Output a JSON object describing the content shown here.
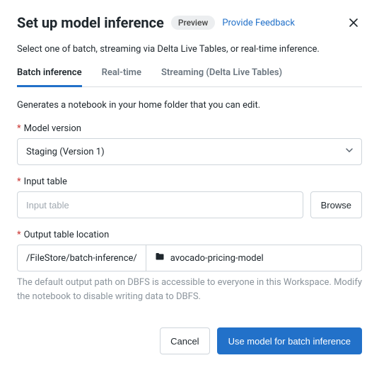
{
  "header": {
    "title": "Set up model inference",
    "badge": "Preview",
    "feedback": "Provide Feedback"
  },
  "subtitle": "Select one of batch, streaming via Delta Live Tables, or real-time inference.",
  "tabs": [
    {
      "label": "Batch inference",
      "active": true
    },
    {
      "label": "Real-time",
      "active": false
    },
    {
      "label": "Streaming (Delta Live Tables)",
      "active": false
    }
  ],
  "description": "Generates a notebook in your home folder that you can edit.",
  "fields": {
    "model_version": {
      "label": "Model version",
      "value": "Staging (Version 1)"
    },
    "input_table": {
      "label": "Input table",
      "placeholder": "Input table",
      "value": "",
      "browse": "Browse"
    },
    "output_location": {
      "label": "Output table location",
      "prefix": "/FileStore/batch-inference/",
      "name": "avocado-pricing-model",
      "helper": "The default output path on DBFS is accessible to everyone in this Workspace. Modify the notebook to disable writing data to DBFS."
    }
  },
  "footer": {
    "cancel": "Cancel",
    "submit": "Use model for batch inference"
  }
}
